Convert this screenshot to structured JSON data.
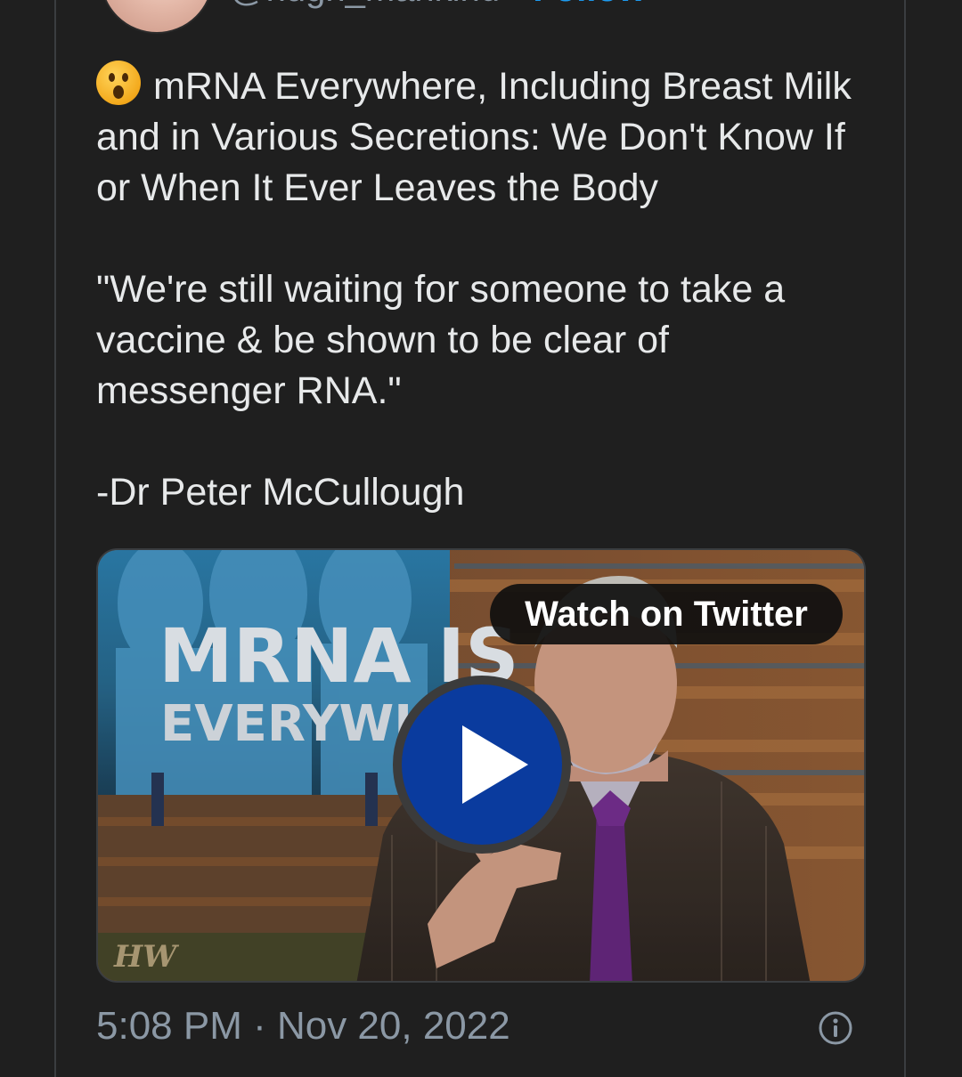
{
  "author": {
    "handle": "@hugh_mankind",
    "separator": "·",
    "follow_label": "Follow"
  },
  "tweet": {
    "emoji": "astonished-face",
    "lines": [
      "mRNA Everywhere, Including Breast Milk and in Various Secretions: We Don't Know If or When It Ever Leaves the Body",
      "\"We're still waiting for someone to take a vaccine & be shown to be clear of messenger RNA.\"",
      "-Dr Peter McCullough"
    ]
  },
  "media": {
    "thumbnail_text_line1": "MRNA IS",
    "thumbnail_text_line2": "EVERYWHERE",
    "watermark": "HW",
    "watch_label": "Watch on Twitter"
  },
  "footer": {
    "timestamp": "5:08 PM · Nov 20, 2022"
  },
  "colors": {
    "background": "#1f1f1f",
    "text": "#e7e9ea",
    "muted": "#8b98a5",
    "accent": "#1d9bf0",
    "play": "#0a3b9e"
  }
}
